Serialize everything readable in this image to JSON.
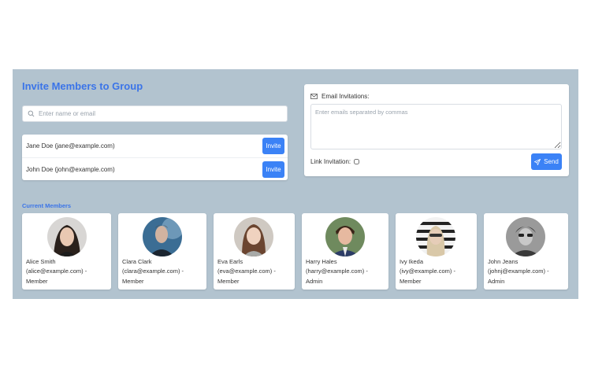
{
  "header": {
    "title": "Invite Members to Group"
  },
  "search": {
    "placeholder": "Enter name or email"
  },
  "results": [
    {
      "label": "Jane Doe (jane@example.com)",
      "button": "Invite"
    },
    {
      "label": "John Doe (john@example.com)",
      "button": "Invite"
    }
  ],
  "email_invite": {
    "label": "Email Invitations:",
    "placeholder": "Enter emails separated by commas",
    "link_label": "Link Invitation:",
    "send_label": "Send"
  },
  "members": {
    "title": "Current Members",
    "items": [
      {
        "name": "Alice Smith",
        "email": "(alice@example.com) -",
        "role": "Member"
      },
      {
        "name": "Clara Clark",
        "email": "(clara@example.com) -",
        "role": "Member"
      },
      {
        "name": "Eva Earls",
        "email": "(eva@example.com) -",
        "role": "Member"
      },
      {
        "name": "Harry Hales",
        "email": "(harry@example.com) -",
        "role": "Admin"
      },
      {
        "name": "Ivy Ikeda",
        "email": "(ivy@example.com) -",
        "role": "Member"
      },
      {
        "name": "John Jeans",
        "email": "(johnj@example.com) -",
        "role": "Admin"
      }
    ]
  },
  "colors": {
    "accent": "#3b82f6",
    "title": "#3b74e8",
    "panel": "#b2c3cf"
  }
}
